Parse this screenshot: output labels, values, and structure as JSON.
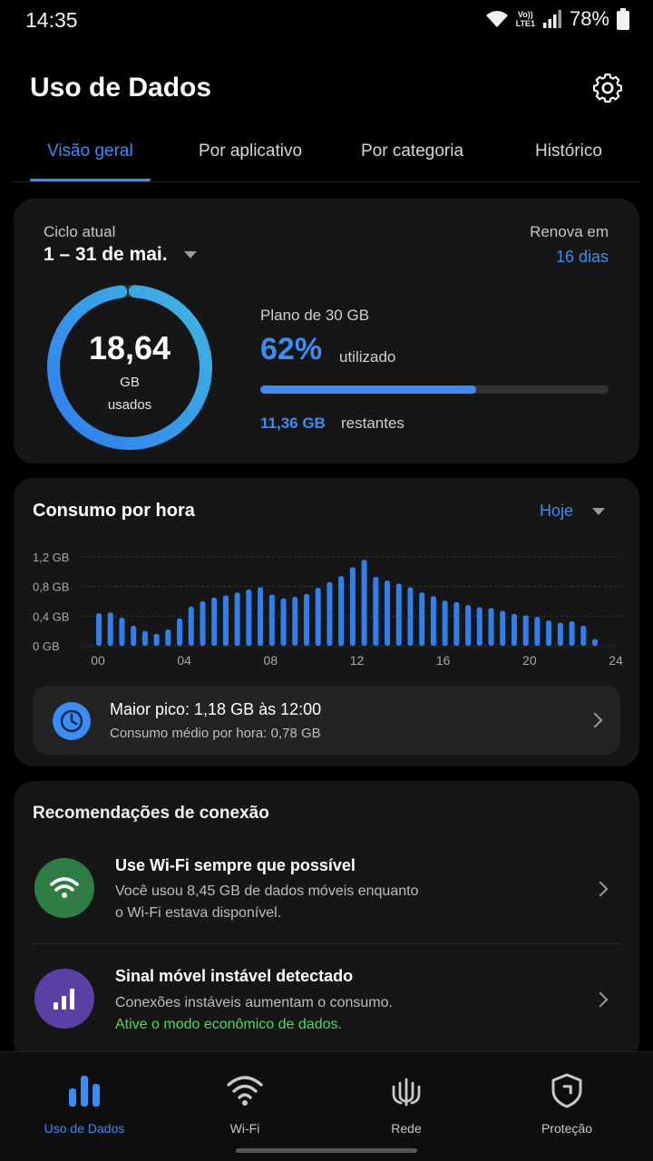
{
  "status_bar": {
    "time": "14:35",
    "volte": "Vo))",
    "lte": "LTE1",
    "battery": "78%"
  },
  "header": {
    "title": "Uso de Dados"
  },
  "tabs": [
    {
      "label": "Visão geral",
      "active": true
    },
    {
      "label": "Por aplicativo",
      "active": false
    },
    {
      "label": "Por categoria",
      "active": false
    },
    {
      "label": "Histórico",
      "active": false
    }
  ],
  "summary": {
    "cycle_label": "Ciclo atual",
    "cycle_value": "1 – 31 de mai.",
    "renew_label": "Renova em",
    "renew_value": "16 dias",
    "used_value": "18,64",
    "used_unit": "GB",
    "used_label": "usados",
    "plan_label": "Plano de 30 GB",
    "percent_text": "62%",
    "percent_value": 62,
    "percent_word": "utilizado",
    "remaining_value": "11,36 GB",
    "remaining_word": "restantes"
  },
  "hourly": {
    "title": "Consumo por hora",
    "filter": "Hoje",
    "peak_title": "Maior pico: 1,18 GB às 12:00",
    "peak_sub": "Consumo médio por hora: 0,78 GB"
  },
  "chart_data": {
    "type": "bar",
    "title": "",
    "xlabel": "",
    "ylabel": "",
    "ylim": [
      0,
      1.2
    ],
    "y_ticks": [
      "0 GB",
      "0,4 GB",
      "0,8 GB",
      "1,2 GB"
    ],
    "x_ticks": [
      "00",
      "04",
      "08",
      "12",
      "16",
      "20",
      "24"
    ],
    "grid": true,
    "color": "#2f80ed",
    "values": [
      0.44,
      0.45,
      0.38,
      0.27,
      0.2,
      0.16,
      0.22,
      0.37,
      0.53,
      0.6,
      0.65,
      0.68,
      0.72,
      0.76,
      0.79,
      0.69,
      0.64,
      0.66,
      0.7,
      0.78,
      0.86,
      0.94,
      1.06,
      1.16,
      0.93,
      0.88,
      0.84,
      0.79,
      0.72,
      0.67,
      0.61,
      0.59,
      0.55,
      0.52,
      0.51,
      0.47,
      0.43,
      0.41,
      0.39,
      0.34,
      0.31,
      0.33,
      0.27,
      0.09
    ]
  },
  "recommendations": {
    "title": "Recomendações de conexão",
    "items": [
      {
        "title": "Use Wi-Fi sempre que possível",
        "line1": "Você usou 8,45 GB de dados móveis enquanto",
        "line2": "o Wi-Fi estava disponível.",
        "icon": "wifi-icon",
        "color": "#2e7d45"
      },
      {
        "title": "Sinal móvel instável detectado",
        "line1": "Conexões instáveis aumentam o consumo.",
        "line2": "Ative o modo econômico de dados.",
        "icon": "signal-bars-icon",
        "color": "#5b3fa5"
      }
    ]
  },
  "bottom_nav": [
    {
      "label": "Uso de Dados",
      "icon": "bar-chart-icon",
      "active": true
    },
    {
      "label": "Wi-Fi",
      "icon": "wifi-icon",
      "active": false
    },
    {
      "label": "Rede",
      "icon": "antenna-icon",
      "active": false
    },
    {
      "label": "Proteção",
      "icon": "shield-icon",
      "active": false
    }
  ],
  "colors": {
    "accent": "#3b8cf5",
    "positive": "#4cd964",
    "card": "#161616",
    "background": "#000000"
  }
}
